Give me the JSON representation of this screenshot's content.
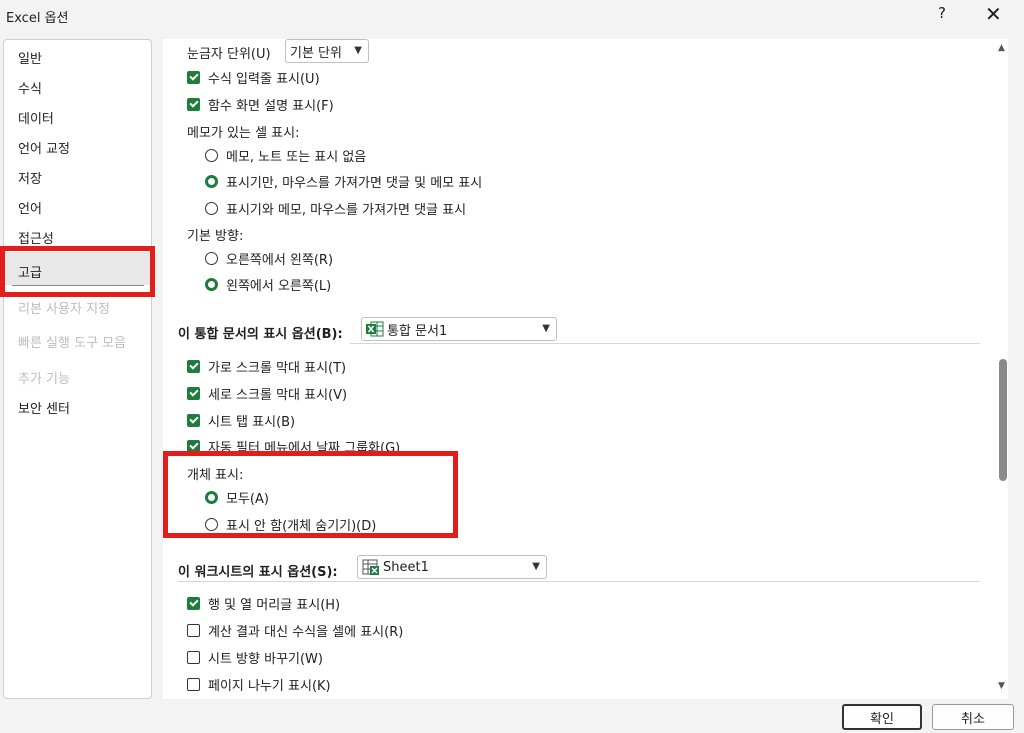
{
  "window": {
    "title": "Excel 옵션",
    "help_glyph": "?",
    "close_glyph": "✕"
  },
  "sidebar": {
    "items": [
      {
        "label": "일반",
        "disabled": false
      },
      {
        "label": "수식",
        "disabled": false
      },
      {
        "label": "데이터",
        "disabled": false
      },
      {
        "label": "언어 교정",
        "disabled": false
      },
      {
        "label": "저장",
        "disabled": false
      },
      {
        "label": "언어",
        "disabled": false
      },
      {
        "label": "접근성",
        "disabled": false
      },
      {
        "label": "고급",
        "disabled": false,
        "selected": true
      },
      {
        "label": "리본 사용자 지정",
        "disabled": true
      },
      {
        "label": "빠른 실행 도구 모음",
        "disabled": true
      },
      {
        "label": "추가 기능",
        "disabled": true
      },
      {
        "label": "보안 센터",
        "disabled": false
      }
    ]
  },
  "content": {
    "ruler_units": {
      "label": "눈금자 단위(U)",
      "value": "기본 단위"
    },
    "show_formula_bar": {
      "label": "수식 입력줄 표시(U)",
      "checked": true
    },
    "show_function_tooltips": {
      "label": "함수 화면 설명 표시(F)",
      "checked": true
    },
    "comments_heading": "메모가 있는 셀 표시:",
    "comments_options": [
      {
        "label": "메모, 노트 또는 표시 없음",
        "selected": false
      },
      {
        "label": "표시기만, 마우스를 가져가면 댓글 및 메모 표시",
        "selected": true
      },
      {
        "label": "표시기와 메모, 마우스를 가져가면 댓글 표시",
        "selected": false
      }
    ],
    "direction_heading": "기본 방향:",
    "direction_options": [
      {
        "label": "오른쪽에서 왼쪽(R)",
        "selected": false
      },
      {
        "label": "왼쪽에서 오른쪽(L)",
        "selected": true
      }
    ],
    "workbook_section": {
      "label": "이 통합 문서의 표시 옵션(B):",
      "value": "통합 문서1"
    },
    "workbook_options": [
      {
        "label": "가로 스크롤 막대 표시(T)",
        "checked": true
      },
      {
        "label": "세로 스크롤 막대 표시(V)",
        "checked": true
      },
      {
        "label": "시트 탭 표시(B)",
        "checked": true
      },
      {
        "label": "자동 필터 메뉴에서 날짜 그룹화(G)",
        "checked": true
      }
    ],
    "objects_heading": "개체 표시:",
    "objects_options": [
      {
        "label": "모두(A)",
        "selected": true
      },
      {
        "label": "표시 안 함(개체 숨기기)(D)",
        "selected": false
      }
    ],
    "worksheet_section": {
      "label": "이 워크시트의 표시 옵션(S):",
      "value": "Sheet1"
    },
    "worksheet_options": [
      {
        "label": "행 및 열 머리글 표시(H)",
        "checked": true
      },
      {
        "label": "계산 결과 대신 수식을 셀에 표시(R)",
        "checked": false
      },
      {
        "label": "시트 방향 바꾸기(W)",
        "checked": false
      },
      {
        "label": "페이지 나누기 표시(K)",
        "checked": false
      }
    ]
  },
  "footer": {
    "ok_label": "확인",
    "cancel_label": "취소"
  },
  "colors": {
    "accent": "#1e7c3c",
    "highlight": "#e31c1c"
  }
}
